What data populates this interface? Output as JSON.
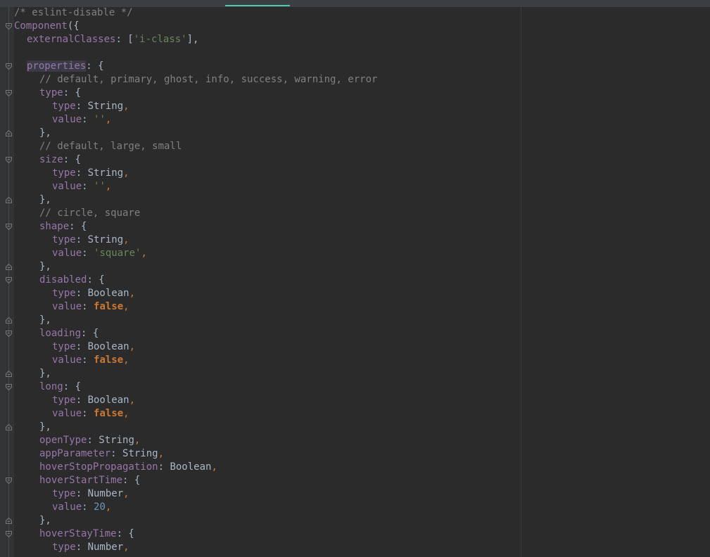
{
  "editor": {
    "lines": [
      "/* eslint-disable */",
      "Component({",
      "  externalClasses: ['i-class'],",
      "",
      "  properties: {",
      "    // default, primary, ghost, info, success, warning, error",
      "    type: {",
      "      type: String,",
      "      value: '',",
      "    },",
      "    // default, large, small",
      "    size: {",
      "      type: String,",
      "      value: '',",
      "    },",
      "    // circle, square",
      "    shape: {",
      "      type: String,",
      "      value: 'square',",
      "    },",
      "    disabled: {",
      "      type: Boolean,",
      "      value: false,",
      "    },",
      "    loading: {",
      "      type: Boolean,",
      "      value: false,",
      "    },",
      "    long: {",
      "      type: Boolean,",
      "      value: false,",
      "    },",
      "    openType: String,",
      "    appParameter: String,",
      "    hoverStopPropagation: Boolean,",
      "    hoverStartTime: {",
      "      type: Number,",
      "      value: 20,",
      "    },",
      "    hoverStayTime: {",
      "      type: Number,"
    ]
  },
  "tokens": {
    "l0_comment": "/* eslint-disable */",
    "l1_component": "Component",
    "l1_open": "({",
    "l2_key": "externalClasses",
    "l2_colon": ": [",
    "l2_str": "'i-class'",
    "l2_close": "],",
    "l4_key": "properties",
    "l4_rest": ": {",
    "l5_comment": "// default, primary, ghost, info, success, warning, error",
    "l6_key": "type",
    "l6_rest": ": {",
    "l7_key": "type",
    "l7_val": "String",
    "l8_key": "value",
    "l8_val": "''",
    "l9": "},",
    "l10_comment": "// default, large, small",
    "l11_key": "size",
    "l11_rest": ": {",
    "l12_key": "type",
    "l12_val": "String",
    "l13_key": "value",
    "l13_val": "''",
    "l14": "},",
    "l15_comment": "// circle, square",
    "l16_key": "shape",
    "l16_rest": ": {",
    "l17_key": "type",
    "l17_val": "String",
    "l18_key": "value",
    "l18_val": "'square'",
    "l19": "},",
    "l20_key": "disabled",
    "l20_rest": ": {",
    "l21_key": "type",
    "l21_val": "Boolean",
    "l22_key": "value",
    "l22_val": "false",
    "l23": "},",
    "l24_key": "loading",
    "l24_rest": ": {",
    "l25_key": "type",
    "l25_val": "Boolean",
    "l26_key": "value",
    "l26_val": "false",
    "l27": "},",
    "l28_key": "long",
    "l28_rest": ": {",
    "l29_key": "type",
    "l29_val": "Boolean",
    "l30_key": "value",
    "l30_val": "false",
    "l31": "},",
    "l32_key": "openType",
    "l32_val": "String",
    "l33_key": "appParameter",
    "l33_val": "String",
    "l34_key": "hoverStopPropagation",
    "l34_val": "Boolean",
    "l35_key": "hoverStartTime",
    "l35_rest": ": {",
    "l36_key": "type",
    "l36_val": "Number",
    "l37_key": "value",
    "l37_val": "20",
    "l38": "},",
    "l39_key": "hoverStayTime",
    "l39_rest": ": {",
    "l40_key": "type",
    "l40_val": "Number"
  },
  "colors": {
    "background": "#2b2b2b",
    "comment": "#808080",
    "property": "#9876aa",
    "string": "#6a8759",
    "keyword": "#cc7832",
    "number": "#6897bb",
    "plain": "#a9b7c6"
  },
  "icons": {
    "fold_open": "fold-open-icon",
    "fold_close": "fold-close-icon"
  }
}
